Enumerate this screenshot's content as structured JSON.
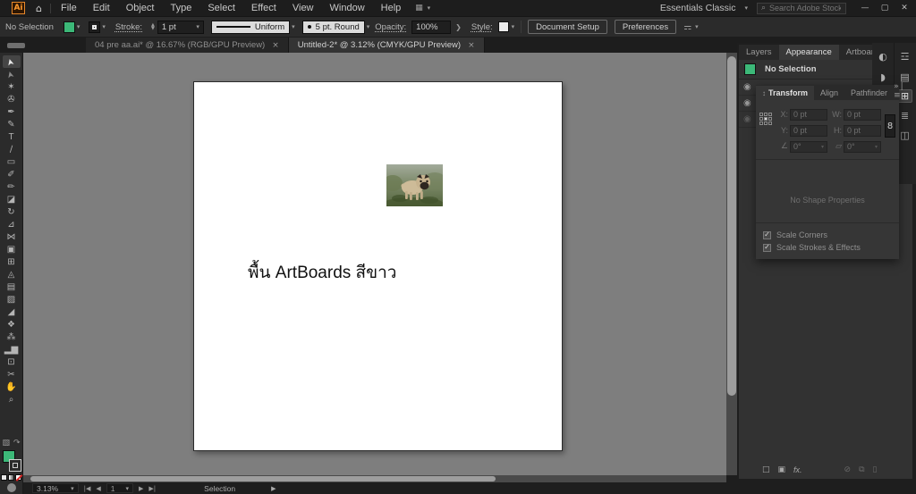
{
  "titlebar": {
    "logo_text": "Ai",
    "menus": [
      "File",
      "Edit",
      "Object",
      "Type",
      "Select",
      "Effect",
      "View",
      "Window",
      "Help"
    ],
    "workspace": "Essentials Classic",
    "search_placeholder": "Search Adobe Stock"
  },
  "control_bar": {
    "no_selection": "No Selection",
    "stroke_label": "Stroke:",
    "stroke_weight": "1 pt",
    "width_profile": "Uniform",
    "brush": "5 pt. Round",
    "opacity_label": "Opacity:",
    "opacity_value": "100%",
    "style_label": "Style:",
    "document_setup": "Document Setup",
    "preferences": "Preferences",
    "fill_color": "#3CB878"
  },
  "document_tabs": [
    {
      "label": "04 pre aa.ai* @ 16.67% (RGB/GPU Preview)",
      "close": "×",
      "active": false
    },
    {
      "label": "Untitled-2* @ 3.12% (CMYK/GPU Preview)",
      "close": "×",
      "active": true
    }
  ],
  "toolbar": {
    "tools": [
      "selection",
      "direct-selection",
      "magic-wand",
      "lasso",
      "pen",
      "curvature",
      "type",
      "line-segment",
      "rectangle",
      "paintbrush",
      "pencil",
      "eraser",
      "rotate",
      "scale",
      "width",
      "free-transform",
      "shape-builder",
      "perspective-grid",
      "mesh",
      "gradient",
      "eyedropper",
      "blend",
      "symbol-sprayer",
      "column-graph",
      "artboard",
      "slice",
      "hand",
      "zoom"
    ],
    "active_tool": "selection"
  },
  "canvas": {
    "artboard_text": "พื้น ArtBoards สีขาว",
    "canvas_color": "#7E7E7E"
  },
  "panels": {
    "dock_tabs": [
      "Layers",
      "Appearance",
      "Artboards"
    ],
    "appearance": {
      "no_selection": "No Selection",
      "fx_label": "fx."
    },
    "transform": {
      "tabs": [
        "Transform",
        "Align",
        "Pathfinder"
      ],
      "x_label": "X:",
      "x_value": "0 pt",
      "y_label": "Y:",
      "y_value": "0 pt",
      "w_label": "W:",
      "w_value": "0 pt",
      "h_label": "H:",
      "h_value": "0 pt",
      "rotate_value": "0°",
      "shear_value": "0°",
      "empty_text": "No Shape Properties",
      "scale_corners": "Scale Corners",
      "scale_strokes": "Scale Strokes & Effects"
    }
  },
  "statusbar": {
    "zoom_level": "3.13%",
    "artboard_number": "1",
    "status_label": "Selection"
  }
}
